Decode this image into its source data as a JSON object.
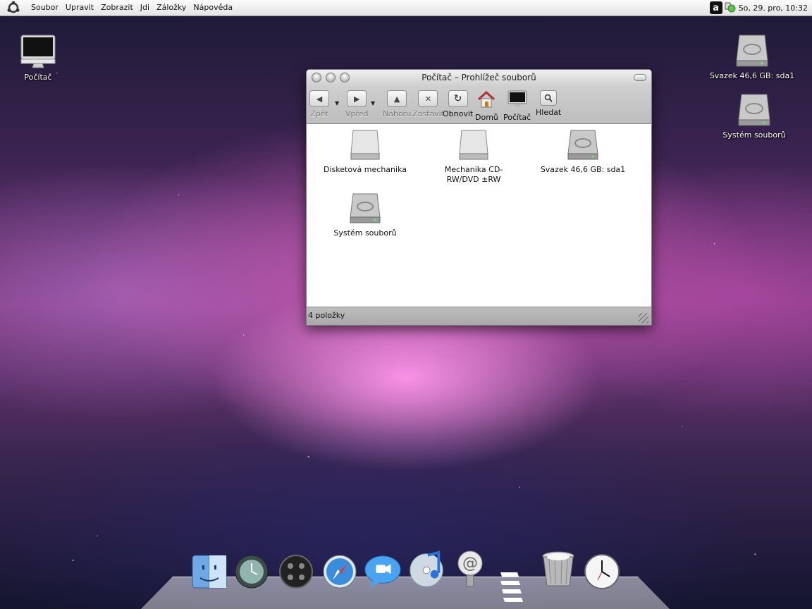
{
  "menubar": {
    "menus": [
      "Soubor",
      "Upravit",
      "Zobrazit",
      "Jdi",
      "Záložky",
      "Nápověda"
    ],
    "tray_letter": "a",
    "clock": "So, 29. pro, 10:32"
  },
  "desktop": {
    "computer": "Počítač",
    "volume": "Svazek 46,6 GB: sda1",
    "filesystem": "Systém souborů"
  },
  "window": {
    "title": "Počítač – Prohlížeč souborů",
    "toolbar": {
      "back": "Zpět",
      "forward": "Vpřed",
      "up": "Nahoru",
      "stop": "Zastavit",
      "reload": "Obnovit",
      "home": "Domů",
      "computer": "Počítač",
      "search": "Hledat"
    },
    "files": [
      {
        "label": "Disketová mechanika",
        "icon": "floppy-drive-icon"
      },
      {
        "label": "Mechanika CD-RW/DVD ±RW",
        "icon": "optical-drive-icon"
      },
      {
        "label": "Svazek 46,6 GB: sda1",
        "icon": "hard-disk-icon"
      },
      {
        "label": "Systém souborů",
        "icon": "hard-disk-icon"
      }
    ],
    "status": "4 položky"
  },
  "dock": {
    "items": [
      "finder-icon",
      "time-machine-icon",
      "dashboard-icon",
      "safari-icon",
      "ichat-icon",
      "itunes-icon",
      "mail-icon",
      "stacks-icon",
      "trash-icon",
      "clock-icon"
    ]
  },
  "colors": {
    "menubar": "#ececec",
    "window_chrome": "#c4c4c4"
  }
}
